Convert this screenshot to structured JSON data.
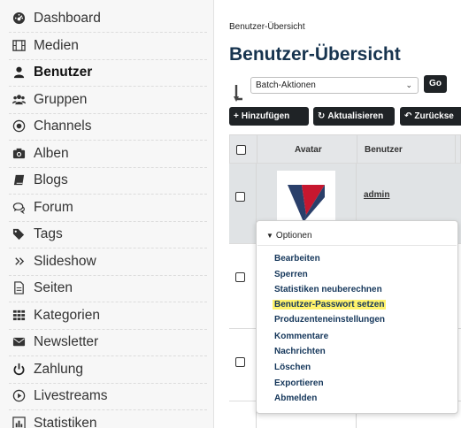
{
  "sidebar": {
    "items": [
      {
        "label": "Dashboard",
        "icon": "dashboard-icon"
      },
      {
        "label": "Medien",
        "icon": "film-icon"
      },
      {
        "label": "Benutzer",
        "icon": "user-icon",
        "active": true
      },
      {
        "label": "Gruppen",
        "icon": "users-icon"
      },
      {
        "label": "Channels",
        "icon": "record-icon"
      },
      {
        "label": "Alben",
        "icon": "camera-icon"
      },
      {
        "label": "Blogs",
        "icon": "book-icon"
      },
      {
        "label": "Forum",
        "icon": "chat-icon"
      },
      {
        "label": "Tags",
        "icon": "tags-icon"
      },
      {
        "label": "Slideshow",
        "icon": "chevrons-right-icon"
      },
      {
        "label": "Seiten",
        "icon": "file-icon"
      },
      {
        "label": "Kategorien",
        "icon": "grid-icon"
      },
      {
        "label": "Newsletter",
        "icon": "envelope-icon"
      },
      {
        "label": "Zahlung",
        "icon": "power-icon"
      },
      {
        "label": "Livestreams",
        "icon": "play-circle-icon"
      },
      {
        "label": "Statistiken",
        "icon": "bar-chart-icon"
      }
    ]
  },
  "main": {
    "breadcrumb": "Benutzer-Übersicht",
    "title": "Benutzer-Übersicht",
    "batch": {
      "selected": "Batch-Aktionen",
      "go_label": "Go"
    },
    "toolbar": {
      "add_label": "Hinzufügen",
      "refresh_label": "Aktualisieren",
      "back_label": "Zurückse"
    },
    "table": {
      "columns": [
        "Avatar",
        "Benutzer"
      ],
      "rows": [
        {
          "username": "admin"
        }
      ]
    },
    "options_menu": {
      "header": "Optionen",
      "items": [
        "Bearbeiten",
        "Sperren",
        "Statistiken neuberechnen",
        "Benutzer-Passwort setzen",
        "Produzenteneinstellungen",
        "Kommentare",
        "Nachrichten",
        "Löschen",
        "Exportieren",
        "Abmelden"
      ],
      "highlighted_item": "Benutzer-Passwort setzen"
    }
  },
  "colors": {
    "title": "#17344f",
    "button_bg": "#1f2326",
    "menu_link": "#14365a",
    "highlight": "#fff36b",
    "avatar_dark": "#2a3f6a",
    "avatar_red": "#c7172f"
  }
}
